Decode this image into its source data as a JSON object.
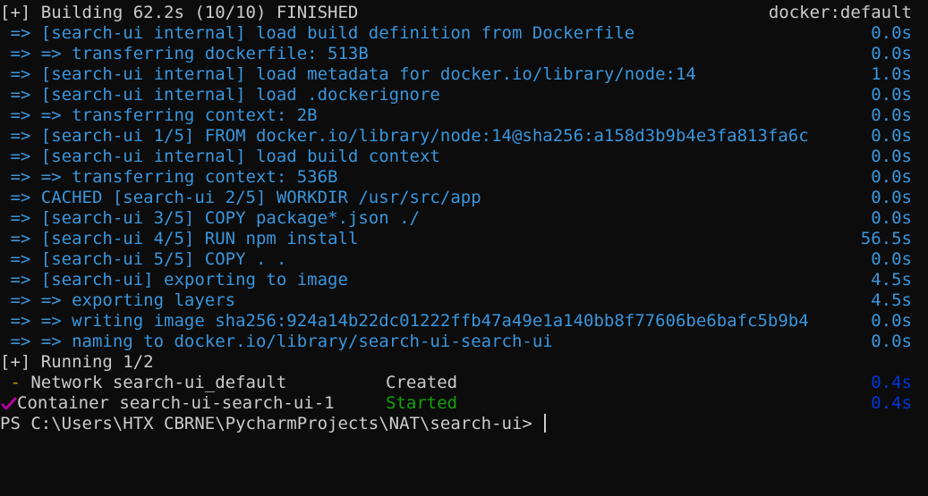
{
  "header": {
    "left": "[+] Building 62.2s (10/10) FINISHED",
    "right": "docker:default"
  },
  "build_steps": [
    {
      "text": " => [search-ui internal] load build definition from Dockerfile",
      "time": "0.0s"
    },
    {
      "text": " => => transferring dockerfile: 513B",
      "time": "0.0s"
    },
    {
      "text": " => [search-ui internal] load metadata for docker.io/library/node:14",
      "time": "1.0s"
    },
    {
      "text": " => [search-ui internal] load .dockerignore",
      "time": "0.0s"
    },
    {
      "text": " => => transferring context: 2B",
      "time": "0.0s"
    },
    {
      "text": " => [search-ui 1/5] FROM docker.io/library/node:14@sha256:a158d3b9b4e3fa813fa6c",
      "time": "0.0s"
    },
    {
      "text": " => [search-ui internal] load build context",
      "time": "0.0s"
    },
    {
      "text": " => => transferring context: 536B",
      "time": "0.0s"
    },
    {
      "text": " => CACHED [search-ui 2/5] WORKDIR /usr/src/app",
      "time": "0.0s"
    },
    {
      "text": " => [search-ui 3/5] COPY package*.json ./",
      "time": "0.0s"
    },
    {
      "text": " => [search-ui 4/5] RUN npm install",
      "time": "56.5s"
    },
    {
      "text": " => [search-ui 5/5] COPY . .",
      "time": "0.0s"
    },
    {
      "text": " => [search-ui] exporting to image",
      "time": "4.5s"
    },
    {
      "text": " => => exporting layers",
      "time": "4.5s"
    },
    {
      "text": " => => writing image sha256:924a14b22dc01222ffb47a49e1a140bb8f77606be6bafc5b9b4",
      "time": "0.0s"
    },
    {
      "text": " => => naming to docker.io/library/search-ui-search-ui",
      "time": "0.0s"
    }
  ],
  "running": "[+] Running 1/2",
  "network": {
    "bullet": " - ",
    "name": "Network search-ui_default",
    "status": "Created",
    "time": "0.4s"
  },
  "container": {
    "name": "Container search-ui-search-ui-1",
    "status": "Started",
    "time": "0.4s"
  },
  "prompt": "PS C:\\Users\\HTX CBRNE\\PycharmProjects\\NAT\\search-ui> ",
  "colors": {
    "background": "#0c0c0c",
    "text": "#cccccc",
    "step_blue": "#3a96dd",
    "time_dark_blue": "#0037da",
    "bullet_yellow": "#c19c00",
    "started_green": "#13a10e",
    "check_purple": "#b4009e"
  },
  "icons": {
    "container_status": "check-icon"
  }
}
